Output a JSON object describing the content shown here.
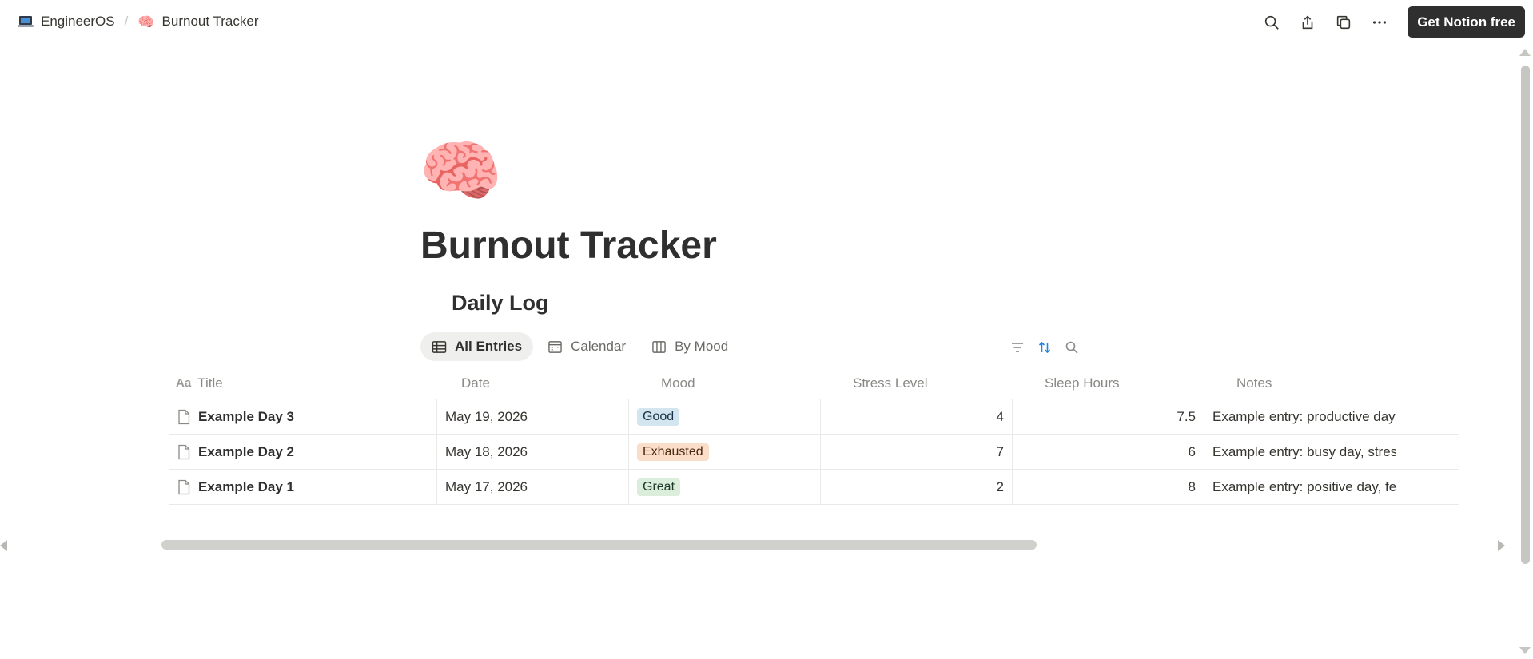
{
  "breadcrumb": {
    "items": [
      {
        "label": "EngineerOS",
        "icon": "laptop-icon"
      },
      {
        "label": "Burnout Tracker",
        "icon": "brain-icon",
        "emoji": "🧠"
      }
    ],
    "separator": "/"
  },
  "topbar": {
    "icons": [
      "search-icon",
      "share-icon",
      "duplicate-icon",
      "more-icon"
    ],
    "cta_label": "Get Notion free",
    "cta_color": "#2f2f2f"
  },
  "page": {
    "icon_emoji": "🧠",
    "title": "Burnout Tracker",
    "database_title": "Daily Log"
  },
  "views": {
    "tabs": [
      {
        "label": "All Entries",
        "icon": "table-icon",
        "active": true
      },
      {
        "label": "Calendar",
        "icon": "calendar-icon",
        "active": false
      },
      {
        "label": "By Mood",
        "icon": "board-icon",
        "active": false
      }
    ],
    "tools": [
      "filter-icon",
      "sort-icon",
      "search-icon"
    ],
    "sort_active_color": "#2383e2"
  },
  "table": {
    "title_prefix": "Aa",
    "columns": [
      "Title",
      "Date",
      "Mood",
      "Stress Level",
      "Sleep Hours",
      "Notes"
    ],
    "rows": [
      {
        "title": "Example Day 3",
        "date": "May 19, 2026",
        "mood": "Good",
        "stress": "4",
        "sleep": "7.5",
        "notes": "Example entry: productive day,"
      },
      {
        "title": "Example Day 2",
        "date": "May 18, 2026",
        "mood": "Exhausted",
        "stress": "7",
        "sleep": "6",
        "notes": "Example entry: busy day, stress"
      },
      {
        "title": "Example Day 1",
        "date": "May 17, 2026",
        "mood": "Great",
        "stress": "2",
        "sleep": "8",
        "notes": "Example entry: positive day, felt"
      }
    ],
    "mood_colors": {
      "Good": {
        "bg": "#d3e5ef",
        "fg": "#183347"
      },
      "Exhausted": {
        "bg": "#fadec9",
        "fg": "#49290e"
      },
      "Great": {
        "bg": "#dbeddb",
        "fg": "#1c3829"
      }
    }
  }
}
